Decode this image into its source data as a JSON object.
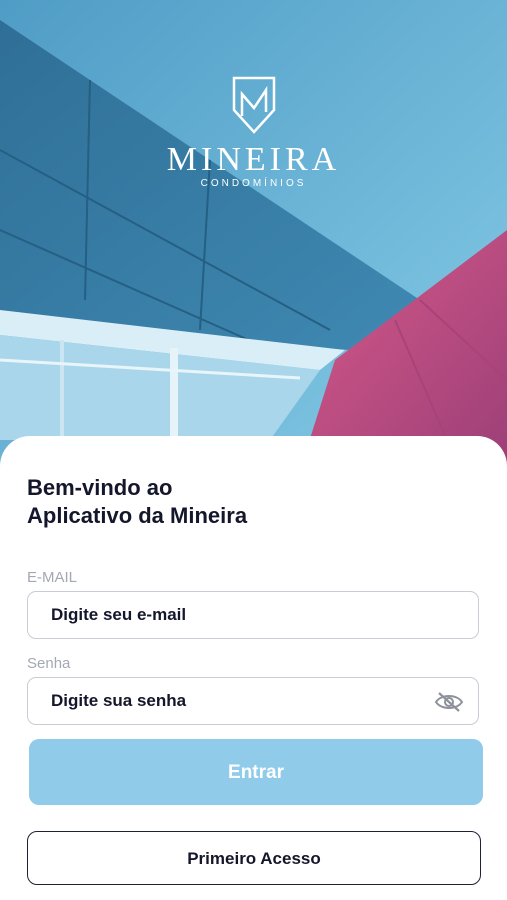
{
  "brand": {
    "name": "MINEIRA",
    "subtitle": "CONDOMÍNIOS"
  },
  "welcome": {
    "line1": "Bem-vindo ao",
    "line2": "Aplicativo da Mineira"
  },
  "email": {
    "label": "E-MAIL",
    "placeholder": "Digite seu e-mail"
  },
  "password": {
    "label": "Senha",
    "placeholder": "Digite sua senha",
    "toggle_icon": "eye-off-icon"
  },
  "buttons": {
    "login": "Entrar",
    "first_access": "Primeiro Acesso"
  },
  "colors": {
    "primary_button": "#90cbea",
    "text_dark": "#14172b",
    "label_gray": "#a4a8b4",
    "sky": "#6fb9dc",
    "magenta": "#c0487e"
  }
}
